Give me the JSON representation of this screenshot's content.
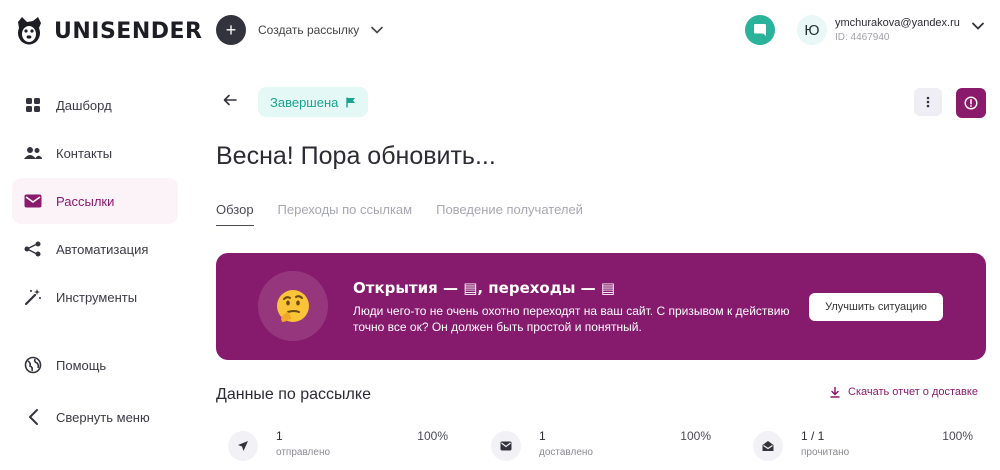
{
  "brand": {
    "name": "UNISENDER"
  },
  "topbar": {
    "create_label": "Создать рассылку",
    "user_initial": "Ю",
    "user_email": "ymchurakova@yandex.ru",
    "user_id": "ID: 4467940"
  },
  "sidebar": {
    "items": [
      {
        "label": "Дашборд",
        "icon": "dashboard-icon"
      },
      {
        "label": "Контакты",
        "icon": "contacts-icon"
      },
      {
        "label": "Рассылки",
        "icon": "mail-icon",
        "active": true
      },
      {
        "label": "Автоматизация",
        "icon": "automation-icon"
      },
      {
        "label": "Инструменты",
        "icon": "tools-icon"
      }
    ],
    "help_label": "Помощь",
    "collapse_label": "Свернуть меню"
  },
  "campaign": {
    "status": "Завершена",
    "title": "Весна! Пора обновить..."
  },
  "tabs": [
    "Обзор",
    "Переходы по ссылкам",
    "Поведение получателей"
  ],
  "banner": {
    "title": "Открытия — ▤, переходы — ▤",
    "text": "Люди чего-то не очень охотно переходят на ваш сайт. С призывом к действию точно все ок? Он должен быть простой и понятный.",
    "button": "Улучшить ситуацию"
  },
  "stats_section": {
    "title": "Данные по рассылке",
    "download_label": "Скачать отчет о доставке",
    "stats": [
      {
        "value": "1",
        "label": "отправлено",
        "percent": "100%",
        "icon": "send-icon"
      },
      {
        "value": "1",
        "label": "доставлено",
        "percent": "100%",
        "icon": "envelope-icon"
      },
      {
        "value": "1 / 1",
        "label": "прочитано",
        "percent": "100%",
        "icon": "open-envelope-icon"
      }
    ]
  },
  "colors": {
    "accent": "#8a1a6c",
    "banner": "#861b6e",
    "status_bg": "#e4f8f5",
    "status_text": "#1aa390",
    "chat": "#2ab39a"
  }
}
